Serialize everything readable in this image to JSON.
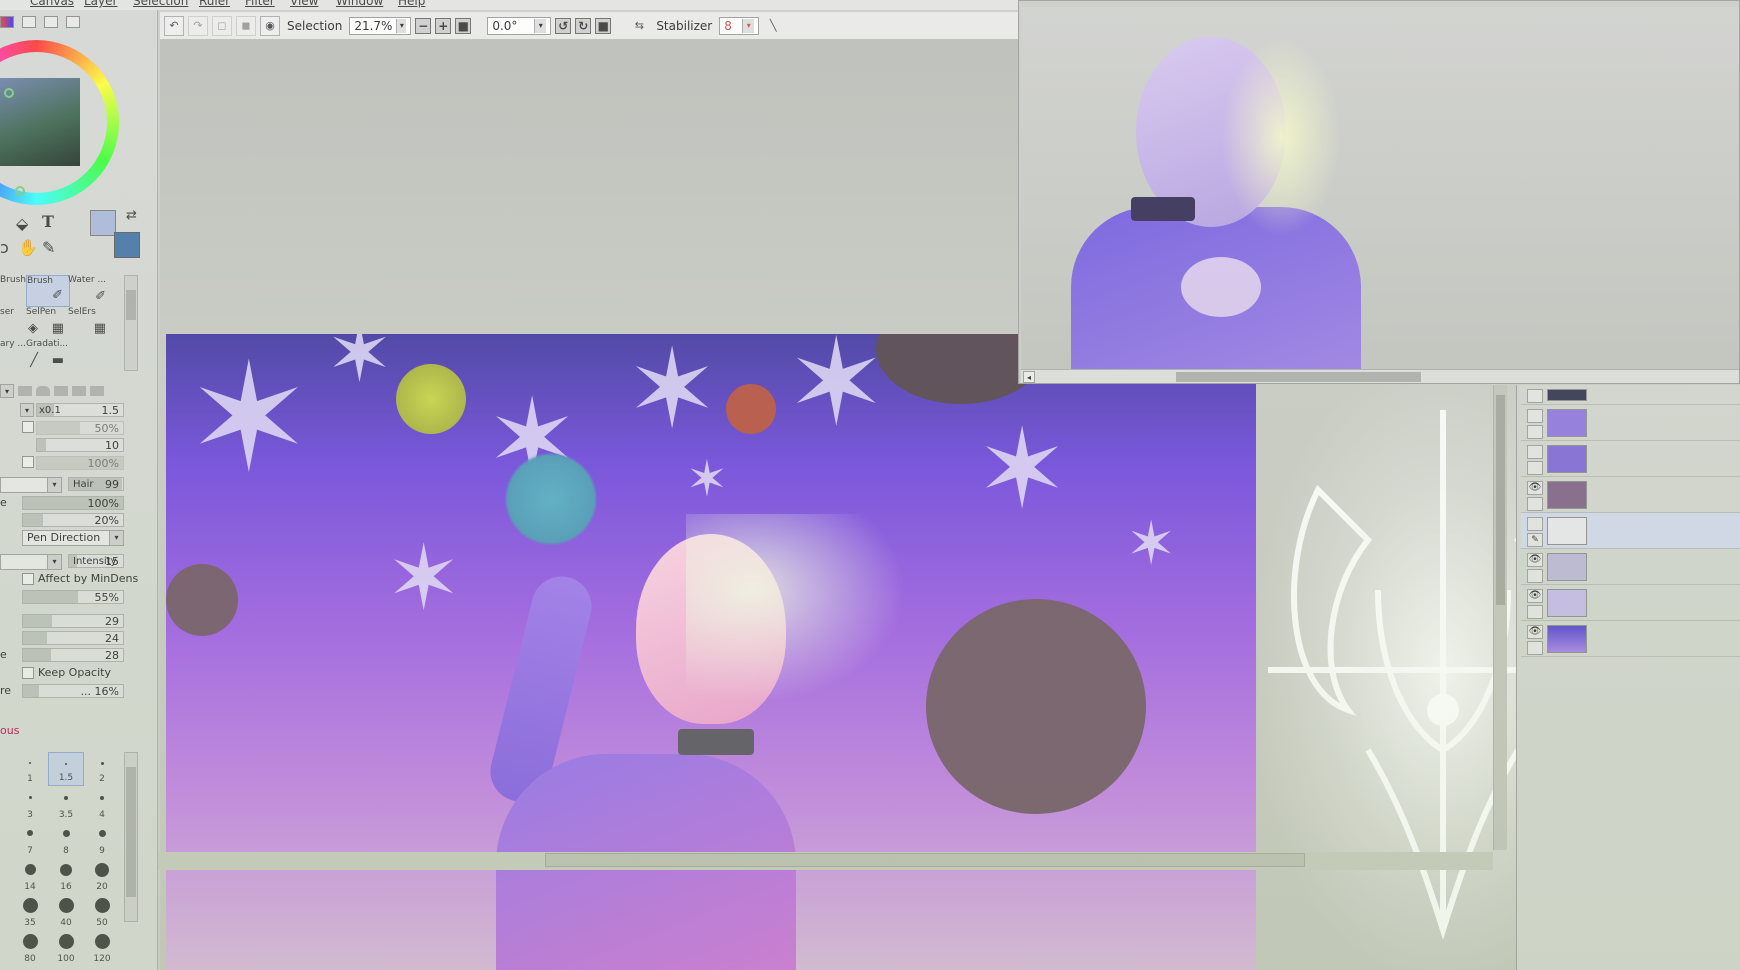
{
  "menu": {
    "items": [
      "Canvas",
      "Layer",
      "Selection",
      "Filter",
      "View",
      "Window",
      "Help"
    ]
  },
  "toolbar": {
    "selection_label": "Selection",
    "zoom": "21.7%",
    "angle": "0.0°",
    "stabilizer_label": "Stabilizer",
    "stabilizer_value": "8"
  },
  "color": {
    "main": "#a8b6d8",
    "sub": "#3e6fa6"
  },
  "tools": [
    {
      "label": "Brush",
      "icon": "brush-icon"
    },
    {
      "label": "Brush",
      "icon": "brush-icon"
    },
    {
      "label": "Water ...",
      "icon": "water-brush-icon"
    },
    {
      "label": "ser",
      "icon": "eraser-icon"
    },
    {
      "label": "SelPen",
      "icon": "selpen-icon"
    },
    {
      "label": "SelErs",
      "icon": "selers-icon"
    },
    {
      "label": "ary ...",
      "icon": "binary-pen-icon"
    },
    {
      "label": "Gradati...",
      "icon": "gradation-icon"
    }
  ],
  "brush_props": {
    "size_mult": "x0.1",
    "size_value": "1.5",
    "min_size": "50%",
    "density": "10",
    "min_density": "100%",
    "shape_label": "Hair",
    "shape_value": "99",
    "blending": "100%",
    "dilution": "20%",
    "texture_mode": "Pen Direction",
    "intensity_label": "Intensity",
    "intensity_value": "15",
    "affect_label": "Affect by MinDens",
    "affect_value": "55%",
    "v1": "29",
    "v2": "24",
    "v3": "28",
    "keep_opacity": "Keep Opacity",
    "last_value": "... 16%",
    "section_label": "ous"
  },
  "brush_sizes": [
    "1",
    "1.5",
    "2",
    "3",
    "3.5",
    "4",
    "7",
    "8",
    "9",
    "14",
    "16",
    "20",
    "35",
    "40",
    "50",
    "80",
    "100",
    "120"
  ],
  "layers": [
    {
      "visible": false
    },
    {
      "visible": false
    },
    {
      "visible": false
    },
    {
      "visible": true
    },
    {
      "visible": false,
      "selected": true
    },
    {
      "visible": true
    },
    {
      "visible": true
    },
    {
      "visible": true
    }
  ]
}
